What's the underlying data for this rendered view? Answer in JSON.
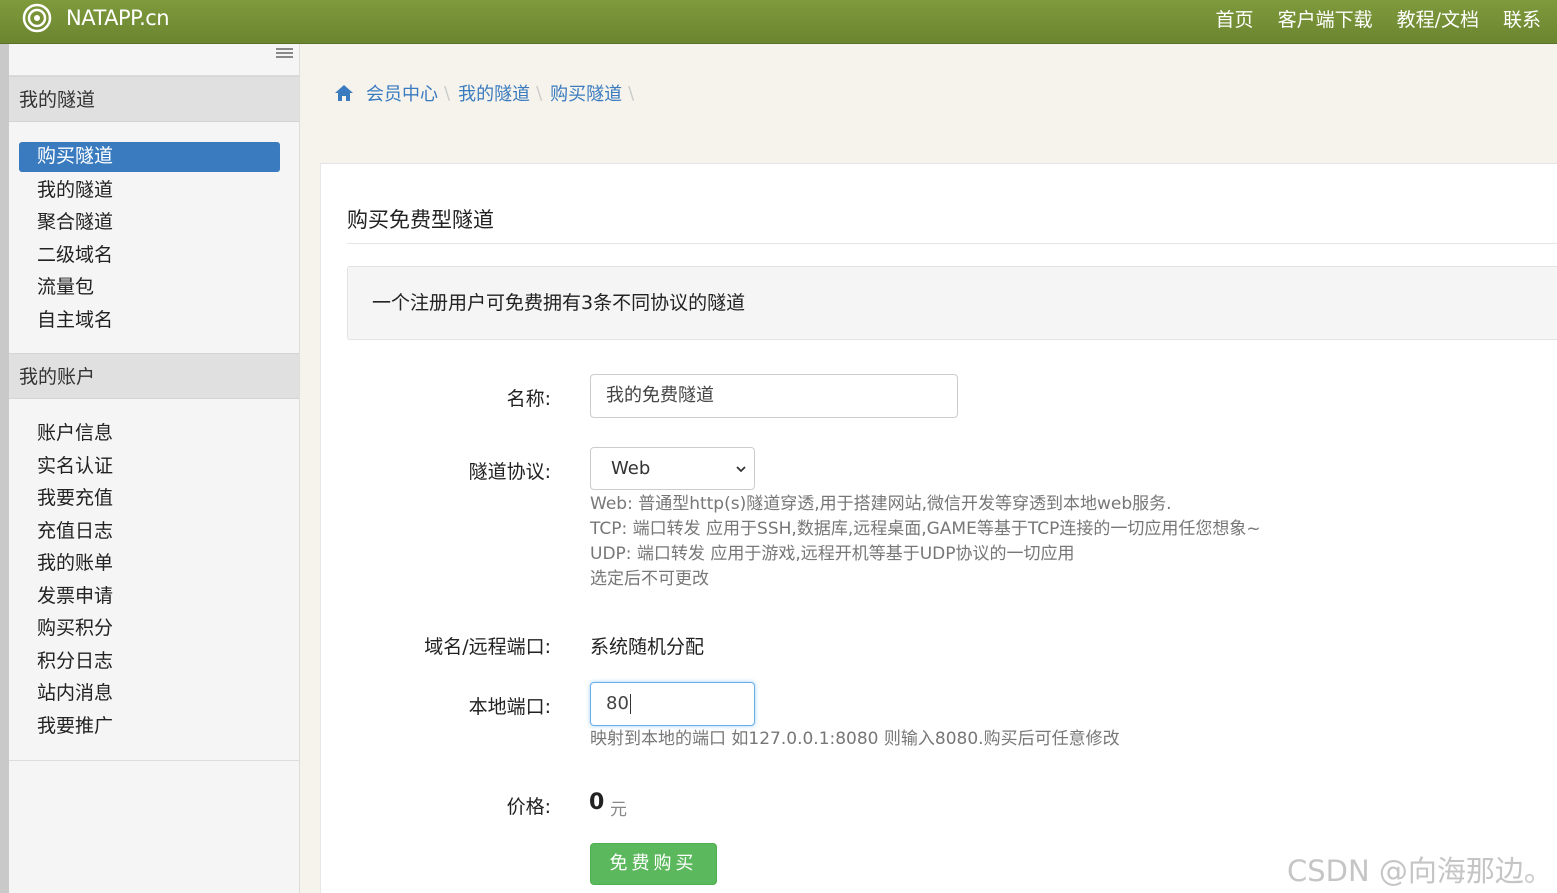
{
  "brand": {
    "name": "NATAPP.cn"
  },
  "nav": {
    "links": [
      "首页",
      "客户端下载",
      "教程/文档",
      "联系"
    ]
  },
  "sidebar": {
    "tunnel_section": "我的隧道",
    "tunnel_items": [
      "购买隧道",
      "我的隧道",
      "聚合隧道",
      "二级域名",
      "流量包",
      "自主域名"
    ],
    "active_item": "购买隧道",
    "account_section": "我的账户",
    "account_items": [
      "账户信息",
      "实名认证",
      "我要充值",
      "充值日志",
      "我的账单",
      "发票申请",
      "购买积分",
      "积分日志",
      "站内消息",
      "我要推广"
    ]
  },
  "breadcrumb": [
    "会员中心",
    "我的隧道",
    "购买隧道"
  ],
  "panel": {
    "title": "购买免费型隧道",
    "notice": "一个注册用户可免费拥有3条不同协议的隧道"
  },
  "form": {
    "name_label": "名称:",
    "name_value": "我的免费隧道",
    "protocol_label": "隧道协议:",
    "protocol_value": "Web",
    "protocol_help": [
      "Web: 普通型http(s)隧道穿透,用于搭建网站,微信开发等穿透到本地web服务.",
      "TCP: 端口转发 应用于SSH,数据库,远程桌面,GAME等基于TCP连接的一切应用任您想象~",
      "UDP: 端口转发 应用于游戏,远程开机等基于UDP协议的一切应用",
      "选定后不可更改"
    ],
    "domain_label": "域名/远程端口:",
    "domain_value": "系统随机分配",
    "local_port_label": "本地端口:",
    "local_port_value": "80",
    "local_port_help": "映射到本地的端口 如127.0.0.1:8080 则输入8080.购买后可任意修改",
    "price_label": "价格:",
    "price_value": "0",
    "price_unit": "元",
    "buy_label": "免费购买"
  },
  "watermark": "CSDN @向海那边。",
  "colors": {
    "navbar": "#728c34",
    "active": "#3a7bbf",
    "link": "#3a7bbf",
    "buy": "#5cb85c"
  }
}
